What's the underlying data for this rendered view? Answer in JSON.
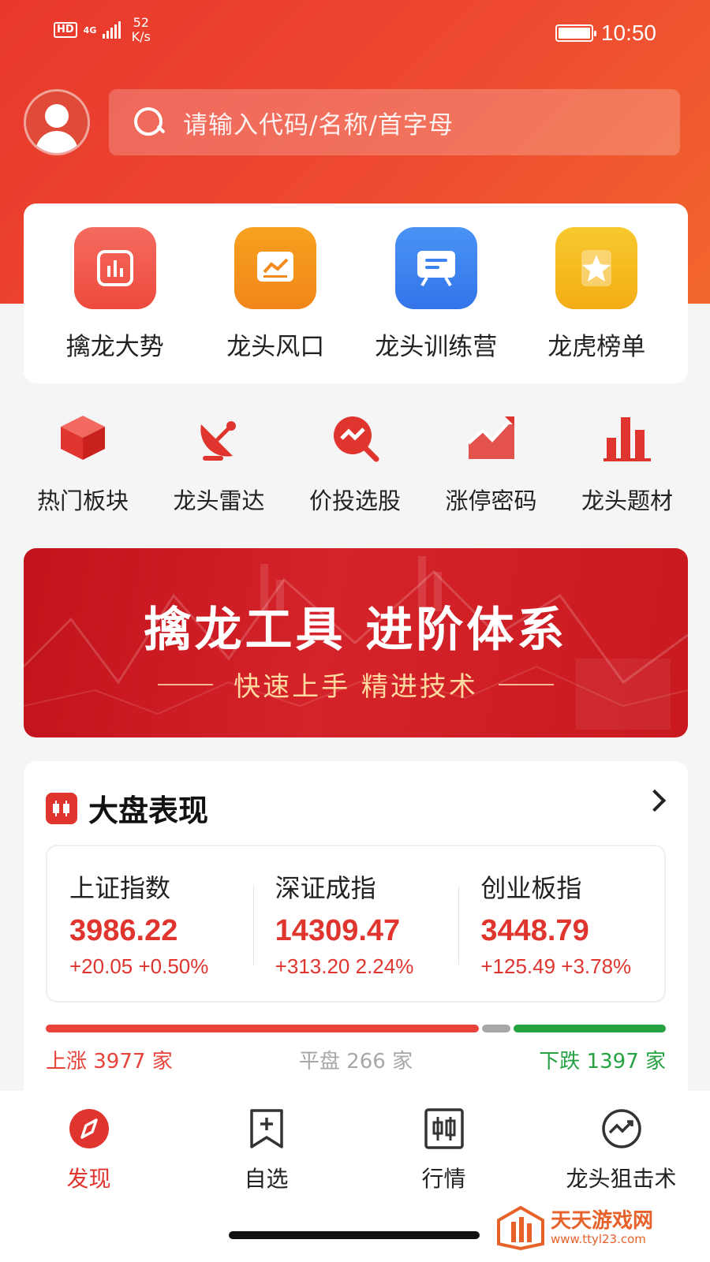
{
  "status_bar": {
    "hd": "HD",
    "network_type": "4G",
    "speed_value": "52",
    "speed_unit": "K/s",
    "time": "10:50"
  },
  "search": {
    "placeholder": "请输入代码/名称/首字母"
  },
  "main_features": [
    {
      "label": "擒龙大势",
      "icon": "bar-chart-icon",
      "color": "#f0574b"
    },
    {
      "label": "龙头风口",
      "icon": "trend-board-icon",
      "color": "#f28a1c"
    },
    {
      "label": "龙头训练营",
      "icon": "presentation-icon",
      "color": "#3d83f0"
    },
    {
      "label": "龙虎榜单",
      "icon": "star-badge-icon",
      "color": "#f4b61c"
    }
  ],
  "secondary_features": [
    {
      "label": "热门板块",
      "icon": "cube-icon"
    },
    {
      "label": "龙头雷达",
      "icon": "radar-dish-icon"
    },
    {
      "label": "价投选股",
      "icon": "search-chart-icon"
    },
    {
      "label": "涨停密码",
      "icon": "trend-up-icon"
    },
    {
      "label": "龙头题材",
      "icon": "column-chart-icon"
    }
  ],
  "banner": {
    "title": "擒龙工具  进阶体系",
    "subtitle": "快速上手 精进技术"
  },
  "market": {
    "title": "大盘表现",
    "indices": [
      {
        "name": "上证指数",
        "value": "3986.22",
        "change": "+20.05  +0.50%"
      },
      {
        "name": "深证成指",
        "value": "14309.47",
        "change": "+313.20  2.24%"
      },
      {
        "name": "创业板指",
        "value": "3448.79",
        "change": "+125.49 +3.78%"
      }
    ],
    "breadth": {
      "up_label": "上涨 3977 家",
      "flat_label": "平盘 266 家",
      "down_label": "下跌 1397 家",
      "up_count": 3977,
      "flat_count": 266,
      "down_count": 1397,
      "up_color": "#e8433b",
      "flat_color": "#a8a8a8",
      "down_color": "#27a243"
    }
  },
  "tabbar": {
    "tabs": [
      {
        "label": "发现",
        "icon": "compass-icon",
        "active": true
      },
      {
        "label": "自选",
        "icon": "bookmark-add-icon",
        "active": false
      },
      {
        "label": "行情",
        "icon": "candlestick-icon",
        "active": false
      },
      {
        "label": "龙头狙击术",
        "icon": "target-trend-icon",
        "active": false
      }
    ]
  },
  "watermark": {
    "title": "天天游戏网",
    "url": "www.ttyl23.com"
  },
  "colors": {
    "brand_red": "#e0352f",
    "header_gradient_start": "#e8382c",
    "header_gradient_end": "#f2662e",
    "banner_subtitle": "#ffd9a0"
  }
}
